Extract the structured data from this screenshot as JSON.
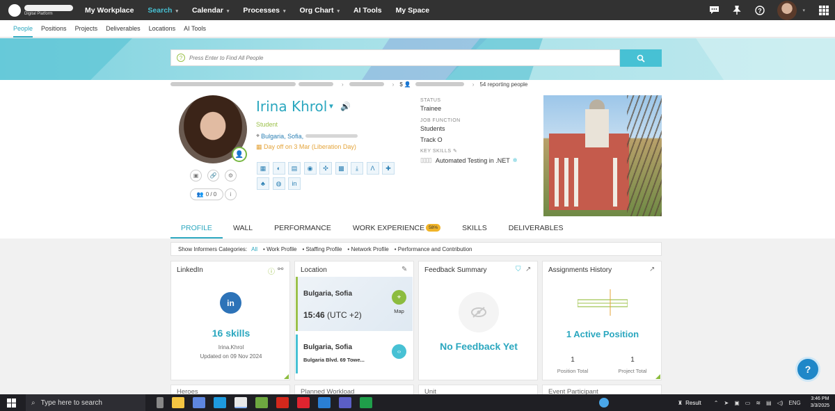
{
  "topbar": {
    "logo_subtitle": "Digital Platform",
    "nav": [
      {
        "label": "My Workplace",
        "has_menu": false
      },
      {
        "label": "Search",
        "has_menu": true,
        "active": true
      },
      {
        "label": "Calendar",
        "has_menu": true
      },
      {
        "label": "Processes",
        "has_menu": true
      },
      {
        "label": "Org Chart",
        "has_menu": true
      },
      {
        "label": "AI Tools",
        "has_menu": false
      },
      {
        "label": "My Space",
        "has_menu": false
      }
    ],
    "icons": [
      "chat-icon",
      "pin-icon",
      "help-icon",
      "user-avatar",
      "apps-grid-icon"
    ]
  },
  "subnav": [
    "People",
    "Positions",
    "Projects",
    "Deliverables",
    "Locations",
    "AI Tools"
  ],
  "search": {
    "placeholder": "Press Enter to Find All People"
  },
  "breadcrumb": {
    "count": "$",
    "reporting": "54 reporting people"
  },
  "profile": {
    "name": "Irina Khrol",
    "role": "Student",
    "location": "Bulgaria, Sofia,",
    "day_off": "Day off on 3 Mar (Liberation Day)",
    "connections": "0 / 0",
    "status_label": "STATUS",
    "status": "Trainee",
    "job_function_label": "JOB FUNCTION",
    "job_function_1": "Students",
    "job_function_2": "Track O",
    "key_skills_label": "KEY SKILLS",
    "key_skill": "Automated Testing in .NET"
  },
  "tabs": [
    {
      "label": "PROFILE",
      "active": true
    },
    {
      "label": "WALL"
    },
    {
      "label": "PERFORMANCE"
    },
    {
      "label": "WORK EXPERIENCE",
      "badge": "58%"
    },
    {
      "label": "SKILLS"
    },
    {
      "label": "DELIVERABLES"
    }
  ],
  "informers": {
    "label": "Show Informers Categories:",
    "all": "All",
    "categories": [
      "Work Profile",
      "Staffing Profile",
      "Network Profile",
      "Performance and Contribution"
    ]
  },
  "cards": {
    "linkedin": {
      "title": "LinkedIn",
      "skills": "16 skills",
      "user": "Irina.Khrol",
      "updated": "Updated on 09 Nov 2024"
    },
    "location": {
      "title": "Location",
      "city1": "Bulgaria, Sofia",
      "time": "15:46",
      "tz": "(UTC +2)",
      "map_label": "Map",
      "city2": "Bulgaria, Sofia",
      "address": "Bulgaria Blvd. 69 Towe..."
    },
    "feedback": {
      "title": "Feedback Summary",
      "empty": "No Feedback Yet"
    },
    "assignments": {
      "title": "Assignments History",
      "active": "1 Active Position",
      "position_total_value": "1",
      "position_total_label": "Position Total",
      "project_total_value": "1",
      "project_total_label": "Project Total"
    }
  },
  "lower_cards": [
    "Heroes",
    "Planned Workload",
    "Unit",
    "Event Participant"
  ],
  "taskbar": {
    "search_placeholder": "Type here to search",
    "tray_result": "Result",
    "lang": "ENG",
    "time": "3:46 PM",
    "date": "3/3/2025"
  },
  "colors": {
    "accent": "#2ba7bf",
    "green": "#8cbc3f",
    "topbar": "#323232",
    "badge": "#f1b428"
  }
}
